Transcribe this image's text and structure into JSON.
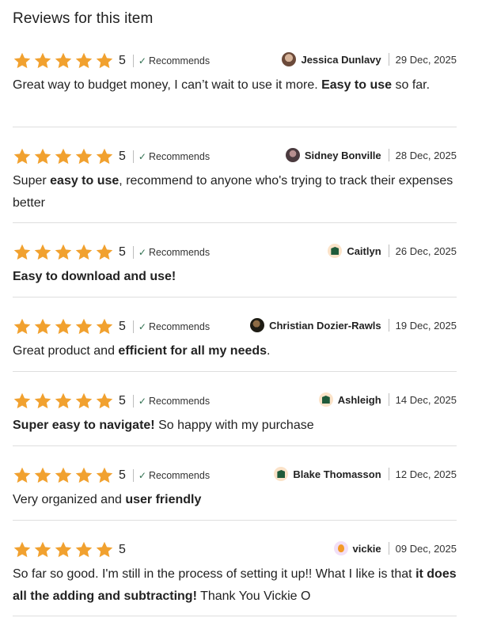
{
  "section_title": "Reviews for this item",
  "colors": {
    "star": "#f1a12f",
    "check": "#2f6f4f",
    "divider": "#dedede"
  },
  "reviews": [
    {
      "rating": "5",
      "recommends": "Recommends",
      "author": "Jessica Dunlavy",
      "date": "29 Dec, 2025",
      "avatar_icon": "user-photo-avatar",
      "text": [
        {
          "t": "Great way to budget money, I can’t wait to use it more. ",
          "b": false
        },
        {
          "t": "Easy to use",
          "b": true
        },
        {
          "t": " so far.",
          "b": false
        }
      ]
    },
    {
      "rating": "5",
      "recommends": "Recommends",
      "author": "Sidney Bonville",
      "date": "28 Dec, 2025",
      "avatar_icon": "user-photo-avatar",
      "text": [
        {
          "t": "Super ",
          "b": false
        },
        {
          "t": "easy to use",
          "b": true
        },
        {
          "t": ", recommend to anyone who's trying to track their expenses better",
          "b": false
        }
      ]
    },
    {
      "rating": "5",
      "recommends": "Recommends",
      "author": "Caitlyn",
      "date": "26 Dec, 2025",
      "avatar_icon": "house-avatar",
      "text": [
        {
          "t": "Easy to download and use!",
          "b": true
        }
      ]
    },
    {
      "rating": "5",
      "recommends": "Recommends",
      "author": "Christian Dozier-Rawls",
      "date": "19 Dec, 2025",
      "avatar_icon": "user-photo-avatar",
      "text": [
        {
          "t": "Great product and ",
          "b": false
        },
        {
          "t": "efficient for all my needs",
          "b": true
        },
        {
          "t": ".",
          "b": false
        }
      ]
    },
    {
      "rating": "5",
      "recommends": "Recommends",
      "author": "Ashleigh",
      "date": "14 Dec, 2025",
      "avatar_icon": "house-avatar",
      "text": [
        {
          "t": "Super easy to navigate!",
          "b": true
        },
        {
          "t": " So happy with my purchase",
          "b": false
        }
      ]
    },
    {
      "rating": "5",
      "recommends": "Recommends",
      "author": "Blake Thomasson",
      "date": "12 Dec, 2025",
      "avatar_icon": "house-avatar",
      "text": [
        {
          "t": "Very organized and ",
          "b": false
        },
        {
          "t": "user friendly",
          "b": true
        }
      ]
    },
    {
      "rating": "5",
      "recommends": "",
      "author": "vickie",
      "date": "09 Dec, 2025",
      "avatar_icon": "default-avatar",
      "text": [
        {
          "t": "So far so good. I'm still in the process of setting it up!! What I like is that ",
          "b": false
        },
        {
          "t": "it does all the adding and subtracting!",
          "b": true
        },
        {
          "t": " Thank You Vickie O",
          "b": false
        }
      ]
    }
  ]
}
